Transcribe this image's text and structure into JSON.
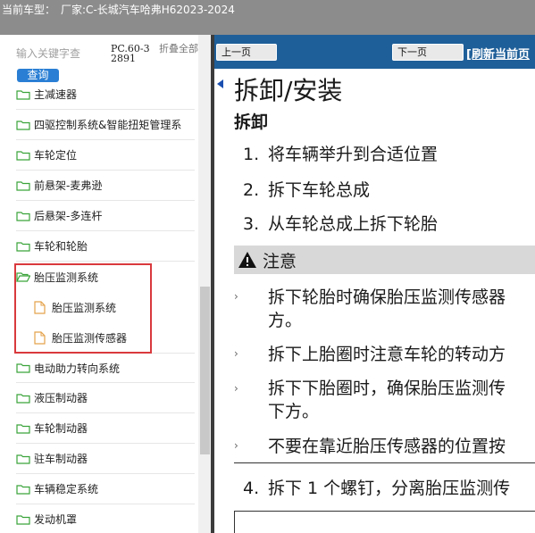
{
  "header": {
    "label": "当前车型：",
    "model": "厂家:C-长城汽车哈弗H62023-2024"
  },
  "sidebar": {
    "search_placeholder": "输入关键字查",
    "search_button": "查询",
    "pc_code": "PC.60-32891",
    "collapse_all": "折叠全部",
    "items": [
      {
        "label": "主减速器"
      },
      {
        "label": "四驱控制系统&智能扭矩管理系"
      },
      {
        "label": "车轮定位"
      },
      {
        "label": "前悬架-麦弗逊"
      },
      {
        "label": "后悬架-多连杆"
      },
      {
        "label": "车轮和轮胎"
      },
      {
        "label": "胎压监测系统"
      },
      {
        "label": "胎压监测系统"
      },
      {
        "label": "胎压监测传感器"
      },
      {
        "label": "电动助力转向系统"
      },
      {
        "label": "液压制动器"
      },
      {
        "label": "车轮制动器"
      },
      {
        "label": "驻车制动器"
      },
      {
        "label": "车辆稳定系统"
      },
      {
        "label": "发动机罩"
      }
    ]
  },
  "toolbar": {
    "prev_label": "上一页",
    "next_label": "下一页",
    "refresh_label": "[刷新当前页"
  },
  "doc": {
    "title": "拆卸/安装",
    "section": "拆卸",
    "steps": [
      {
        "num": "1.",
        "text": "将车辆举升到合适位置"
      },
      {
        "num": "2.",
        "text": "拆下车轮总成"
      },
      {
        "num": "3.",
        "text": "从车轮总成上拆下轮胎"
      }
    ],
    "notice_label": "注意",
    "bullet_glyph": "›",
    "notes": [
      {
        "line1": "拆下轮胎时确保胎压监测传感器",
        "line2": "方。"
      },
      {
        "line1": "拆下上胎圈时注意车轮的转动方",
        "line2": ""
      },
      {
        "line1": "拆下下胎圈时，确保胎压监测传",
        "line2": "下方。"
      },
      {
        "line1": "不要在靠近胎压传感器的位置按",
        "line2": ""
      }
    ],
    "step4": {
      "num": "4.",
      "text": "拆下 1 个螺钉，分离胎压监测传"
    }
  },
  "colors": {
    "header_bg": "#8c8c8c",
    "navbar_bg": "#1f5f99",
    "search_button_bg": "#2a7fd4",
    "highlight_border": "#d9393d",
    "notice_bg": "#d8d8d8"
  }
}
